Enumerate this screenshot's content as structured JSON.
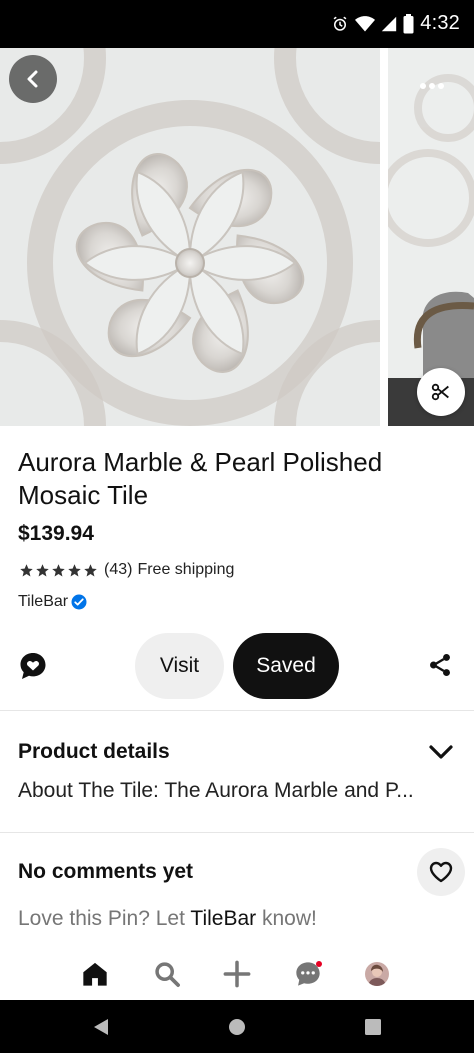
{
  "status_bar": {
    "time": "4:32",
    "icons": [
      "alarm-icon",
      "wifi-icon",
      "signal-icon",
      "battery-icon"
    ]
  },
  "carousel": {
    "back_icon": "chevron-left-icon",
    "more_icon": "ellipsis-icon",
    "crop_icon": "scissors-icon"
  },
  "product": {
    "title": "Aurora Marble & Pearl Polished Mosaic Tile",
    "price": "$139.94",
    "rating_count": "(43)",
    "rating_stars": 5,
    "shipping": "Free shipping",
    "merchant": "TileBar"
  },
  "actions": {
    "comment_icon": "speech-heart-icon",
    "visit_label": "Visit",
    "saved_label": "Saved",
    "share_icon": "share-icon"
  },
  "details": {
    "heading": "Product details",
    "text": "About The Tile: The Aurora Marble and P..."
  },
  "comments": {
    "heading": "No comments yet",
    "prompt_prefix": "Love this Pin? Let ",
    "prompt_merchant": "TileBar",
    "prompt_suffix": " know!"
  },
  "bottom_nav": {
    "items": [
      "home-icon",
      "search-icon",
      "plus-icon",
      "messages-icon",
      "profile-avatar"
    ]
  },
  "colors": {
    "accent_red": "#e60023",
    "verified_blue": "#0074e8",
    "primary_dark": "#111111",
    "button_gray": "#efefef"
  }
}
